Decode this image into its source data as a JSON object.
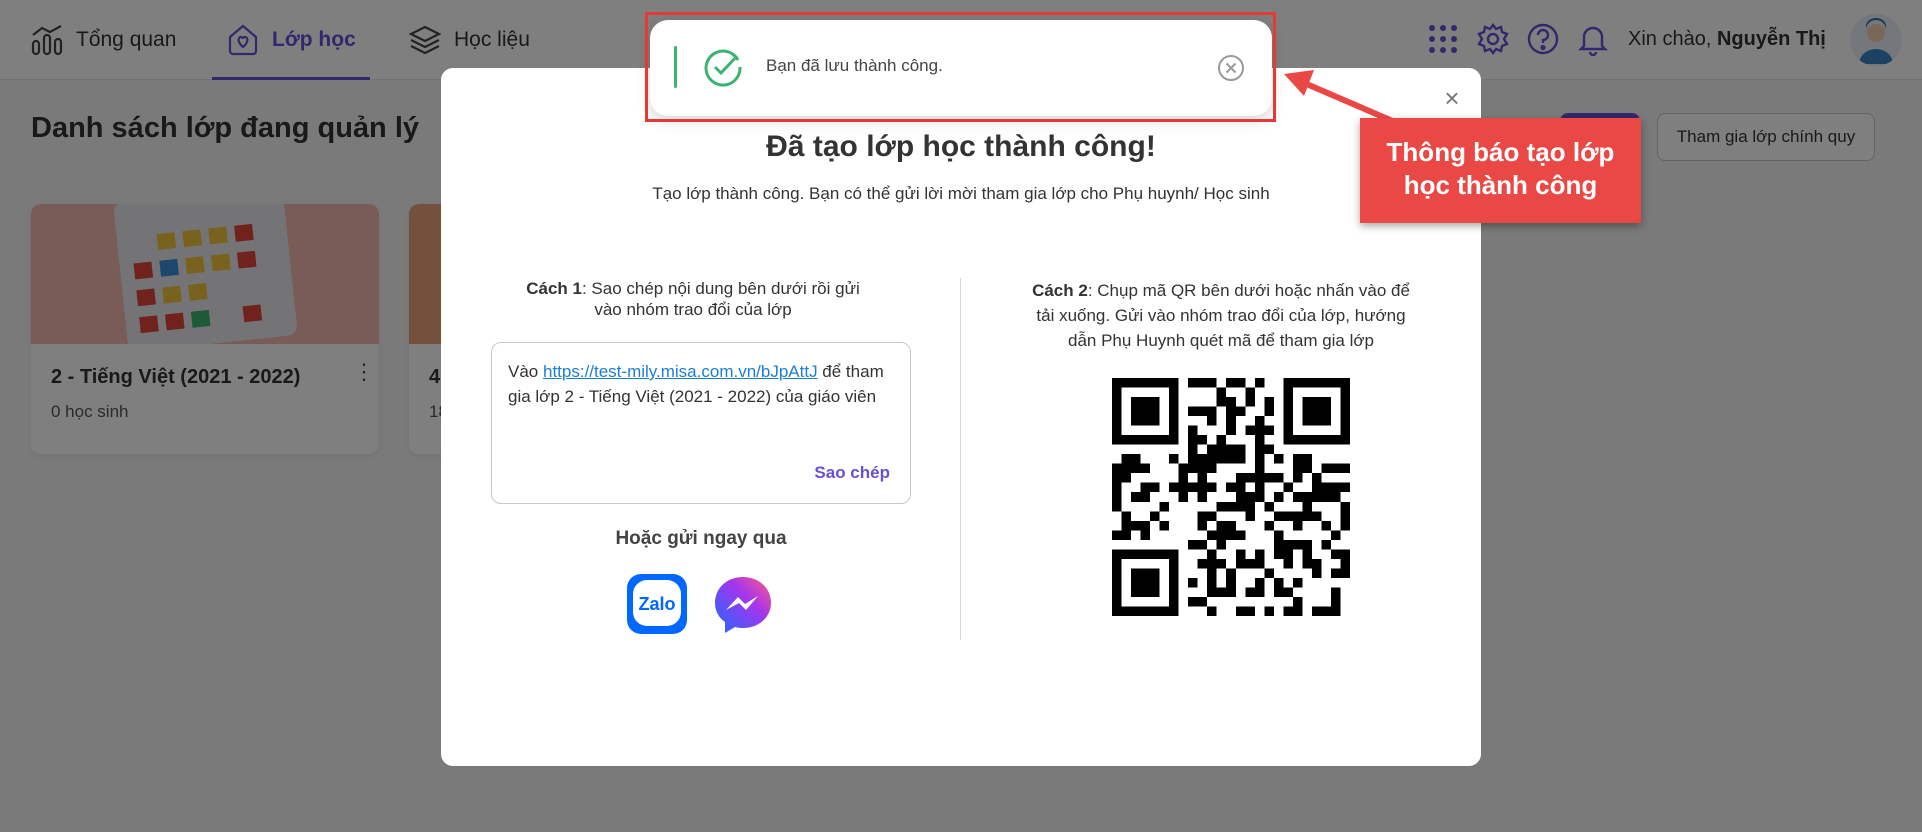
{
  "nav": {
    "items": [
      {
        "label": "Tổng quan",
        "icon": "chart-icon"
      },
      {
        "label": "Lớp học",
        "icon": "heart-house-icon",
        "active": true
      },
      {
        "label": "Học liệu",
        "icon": "layers-icon"
      }
    ]
  },
  "header": {
    "greeting_prefix": "Xin chào,",
    "user_name": "Nguyễn Thị",
    "icons": [
      "apps-grid-icon",
      "gear-icon",
      "help-icon",
      "bell-icon"
    ]
  },
  "page": {
    "title": "Danh sách lớp đang quản lý",
    "join_button": "Tham gia lớp chính quy"
  },
  "classes": [
    {
      "name": "2 - Tiếng Việt (2021 - 2022)",
      "count": "0 học sinh"
    },
    {
      "name": "4",
      "count": "18"
    }
  ],
  "modal": {
    "title": "Đã tạo lớp học thành công!",
    "subtitle": "Tạo lớp thành công. Bạn có thể gửi lời mời tham gia lớp cho Phụ huynh/ Học sinh",
    "step1_label": "Cách 1",
    "step1_text": ": Sao chép nội dung bên dưới rồi gửi vào nhóm trao đổi của lớp",
    "invite_prefix": "Vào ",
    "invite_link": "https://test-mily.misa.com.vn/bJpAttJ",
    "invite_suffix": " để tham gia lớp 2 - Tiếng Việt (2021 - 2022) của giáo viên",
    "copy_label": "Sao chép",
    "send_title": "Hoặc gửi ngay qua",
    "zalo_label": "Zalo",
    "step2_label": "Cách 2",
    "step2_text": ": Chụp mã QR bên dưới hoặc nhấn vào để tải xuống. Gửi vào nhóm trao đổi của lớp, hướng dẫn Phụ Huynh quét mã để tham gia lớp"
  },
  "toast": {
    "message": "Bạn đã lưu thành công."
  },
  "annotation": {
    "text": "Thông báo tạo lớp học thành công"
  },
  "colors": {
    "accent": "#6a4fd6",
    "success": "#3cb371",
    "annotation": "#e94845",
    "link": "#1a7fd6"
  }
}
